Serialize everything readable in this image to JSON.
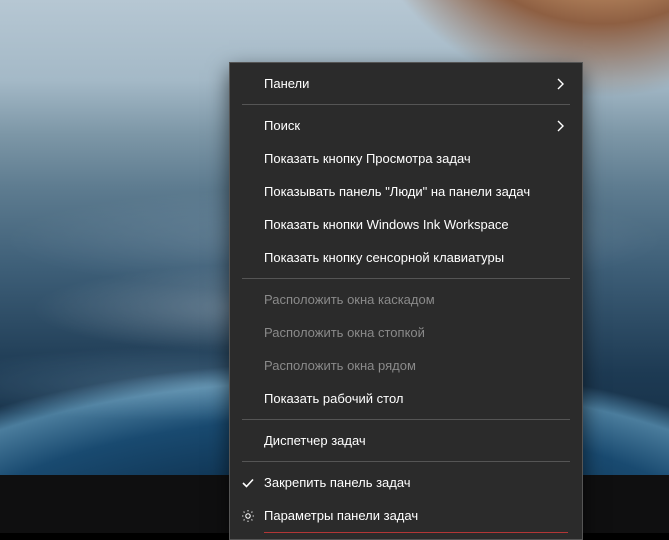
{
  "menu": {
    "panels": "Панели",
    "search": "Поиск",
    "show_taskview_button": "Показать кнопку Просмотра задач",
    "show_people_panel": "Показывать панель \"Люди\" на панели задач",
    "show_ink_workspace": "Показать кнопки Windows Ink Workspace",
    "show_touch_keyboard": "Показать кнопку сенсорной клавиатуры",
    "cascade_windows": "Расположить окна каскадом",
    "stack_windows": "Расположить окна стопкой",
    "side_by_side": "Расположить окна рядом",
    "show_desktop": "Показать рабочий стол",
    "task_manager": "Диспетчер задач",
    "lock_taskbar": "Закрепить панель задач",
    "taskbar_settings": "Параметры панели задач"
  }
}
